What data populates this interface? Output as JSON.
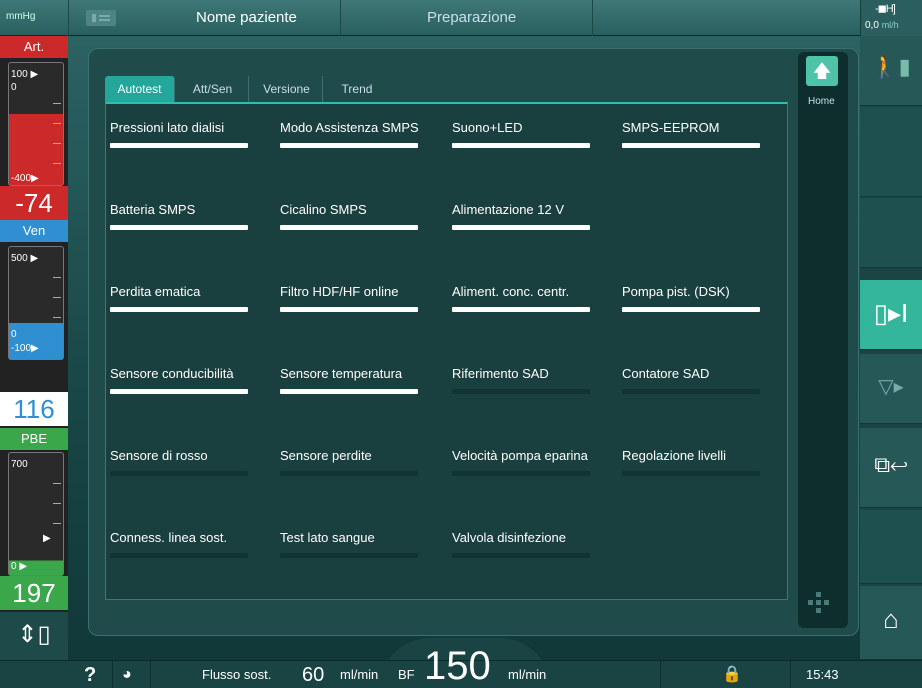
{
  "topbar": {
    "unit": "mmHg",
    "patient_name": "Nome paziente",
    "phase": "Preparazione",
    "battery": "-◼H]",
    "rate_value": "0,0",
    "rate_unit": "ml/h"
  },
  "pressures": {
    "art": {
      "label": "Art.",
      "upper": "100",
      "lower_zero": "0",
      "bottom": "-400",
      "value": "-74",
      "color": "#cc2a2a"
    },
    "ven": {
      "label": "Ven",
      "upper": "500",
      "zero": "0",
      "bottom": "-100",
      "value": "116",
      "color": "#2f8fd0"
    },
    "pbe": {
      "label": "PBE",
      "upper": "700",
      "zero": "0",
      "value": "197",
      "color": "#3aa84a"
    }
  },
  "tabs": [
    {
      "label": "Autotest",
      "active": true
    },
    {
      "label": "Att/Sen",
      "active": false
    },
    {
      "label": "Versione",
      "active": false
    },
    {
      "label": "Trend",
      "active": false
    }
  ],
  "tests": [
    {
      "name": "Pressioni lato dialisi",
      "status": "done"
    },
    {
      "name": "Modo Assistenza SMPS",
      "status": "done"
    },
    {
      "name": "Suono+LED",
      "status": "done"
    },
    {
      "name": "SMPS-EEPROM",
      "status": "done"
    },
    {
      "name": "Batteria SMPS",
      "status": "done"
    },
    {
      "name": "Cicalino SMPS",
      "status": "done"
    },
    {
      "name": "Alimentazione 12 V",
      "status": "done"
    },
    {
      "name": "",
      "status": "none"
    },
    {
      "name": "Perdita ematica",
      "status": "done"
    },
    {
      "name": "Filtro HDF/HF online",
      "status": "done"
    },
    {
      "name": "Aliment. conc. centr.",
      "status": "done"
    },
    {
      "name": "Pompa pist. (DSK)",
      "status": "done"
    },
    {
      "name": "Sensore conducibilità",
      "status": "done"
    },
    {
      "name": "Sensore temperatura",
      "status": "done"
    },
    {
      "name": "Riferimento SAD",
      "status": "pending"
    },
    {
      "name": "Contatore SAD",
      "status": "pending"
    },
    {
      "name": "Sensore di rosso",
      "status": "pending"
    },
    {
      "name": "Sensore perdite",
      "status": "pending"
    },
    {
      "name": "Velocità pompa eparina",
      "status": "pending"
    },
    {
      "name": "Regolazione livelli",
      "status": "pending"
    },
    {
      "name": "Conness. linea sost.",
      "status": "pending"
    },
    {
      "name": "Test lato sangue",
      "status": "pending"
    },
    {
      "name": "Valvola disinfezione",
      "status": "pending"
    }
  ],
  "home": {
    "label": "Home",
    "icon": "up-arrow-icon"
  },
  "bottombar": {
    "help": "?",
    "flow_label": "Flusso sost.",
    "flow_value": "60",
    "flow_unit": "ml/min",
    "bf_label": "BF",
    "bf_value": "150",
    "bf_unit": "ml/min",
    "time": "15:43"
  }
}
